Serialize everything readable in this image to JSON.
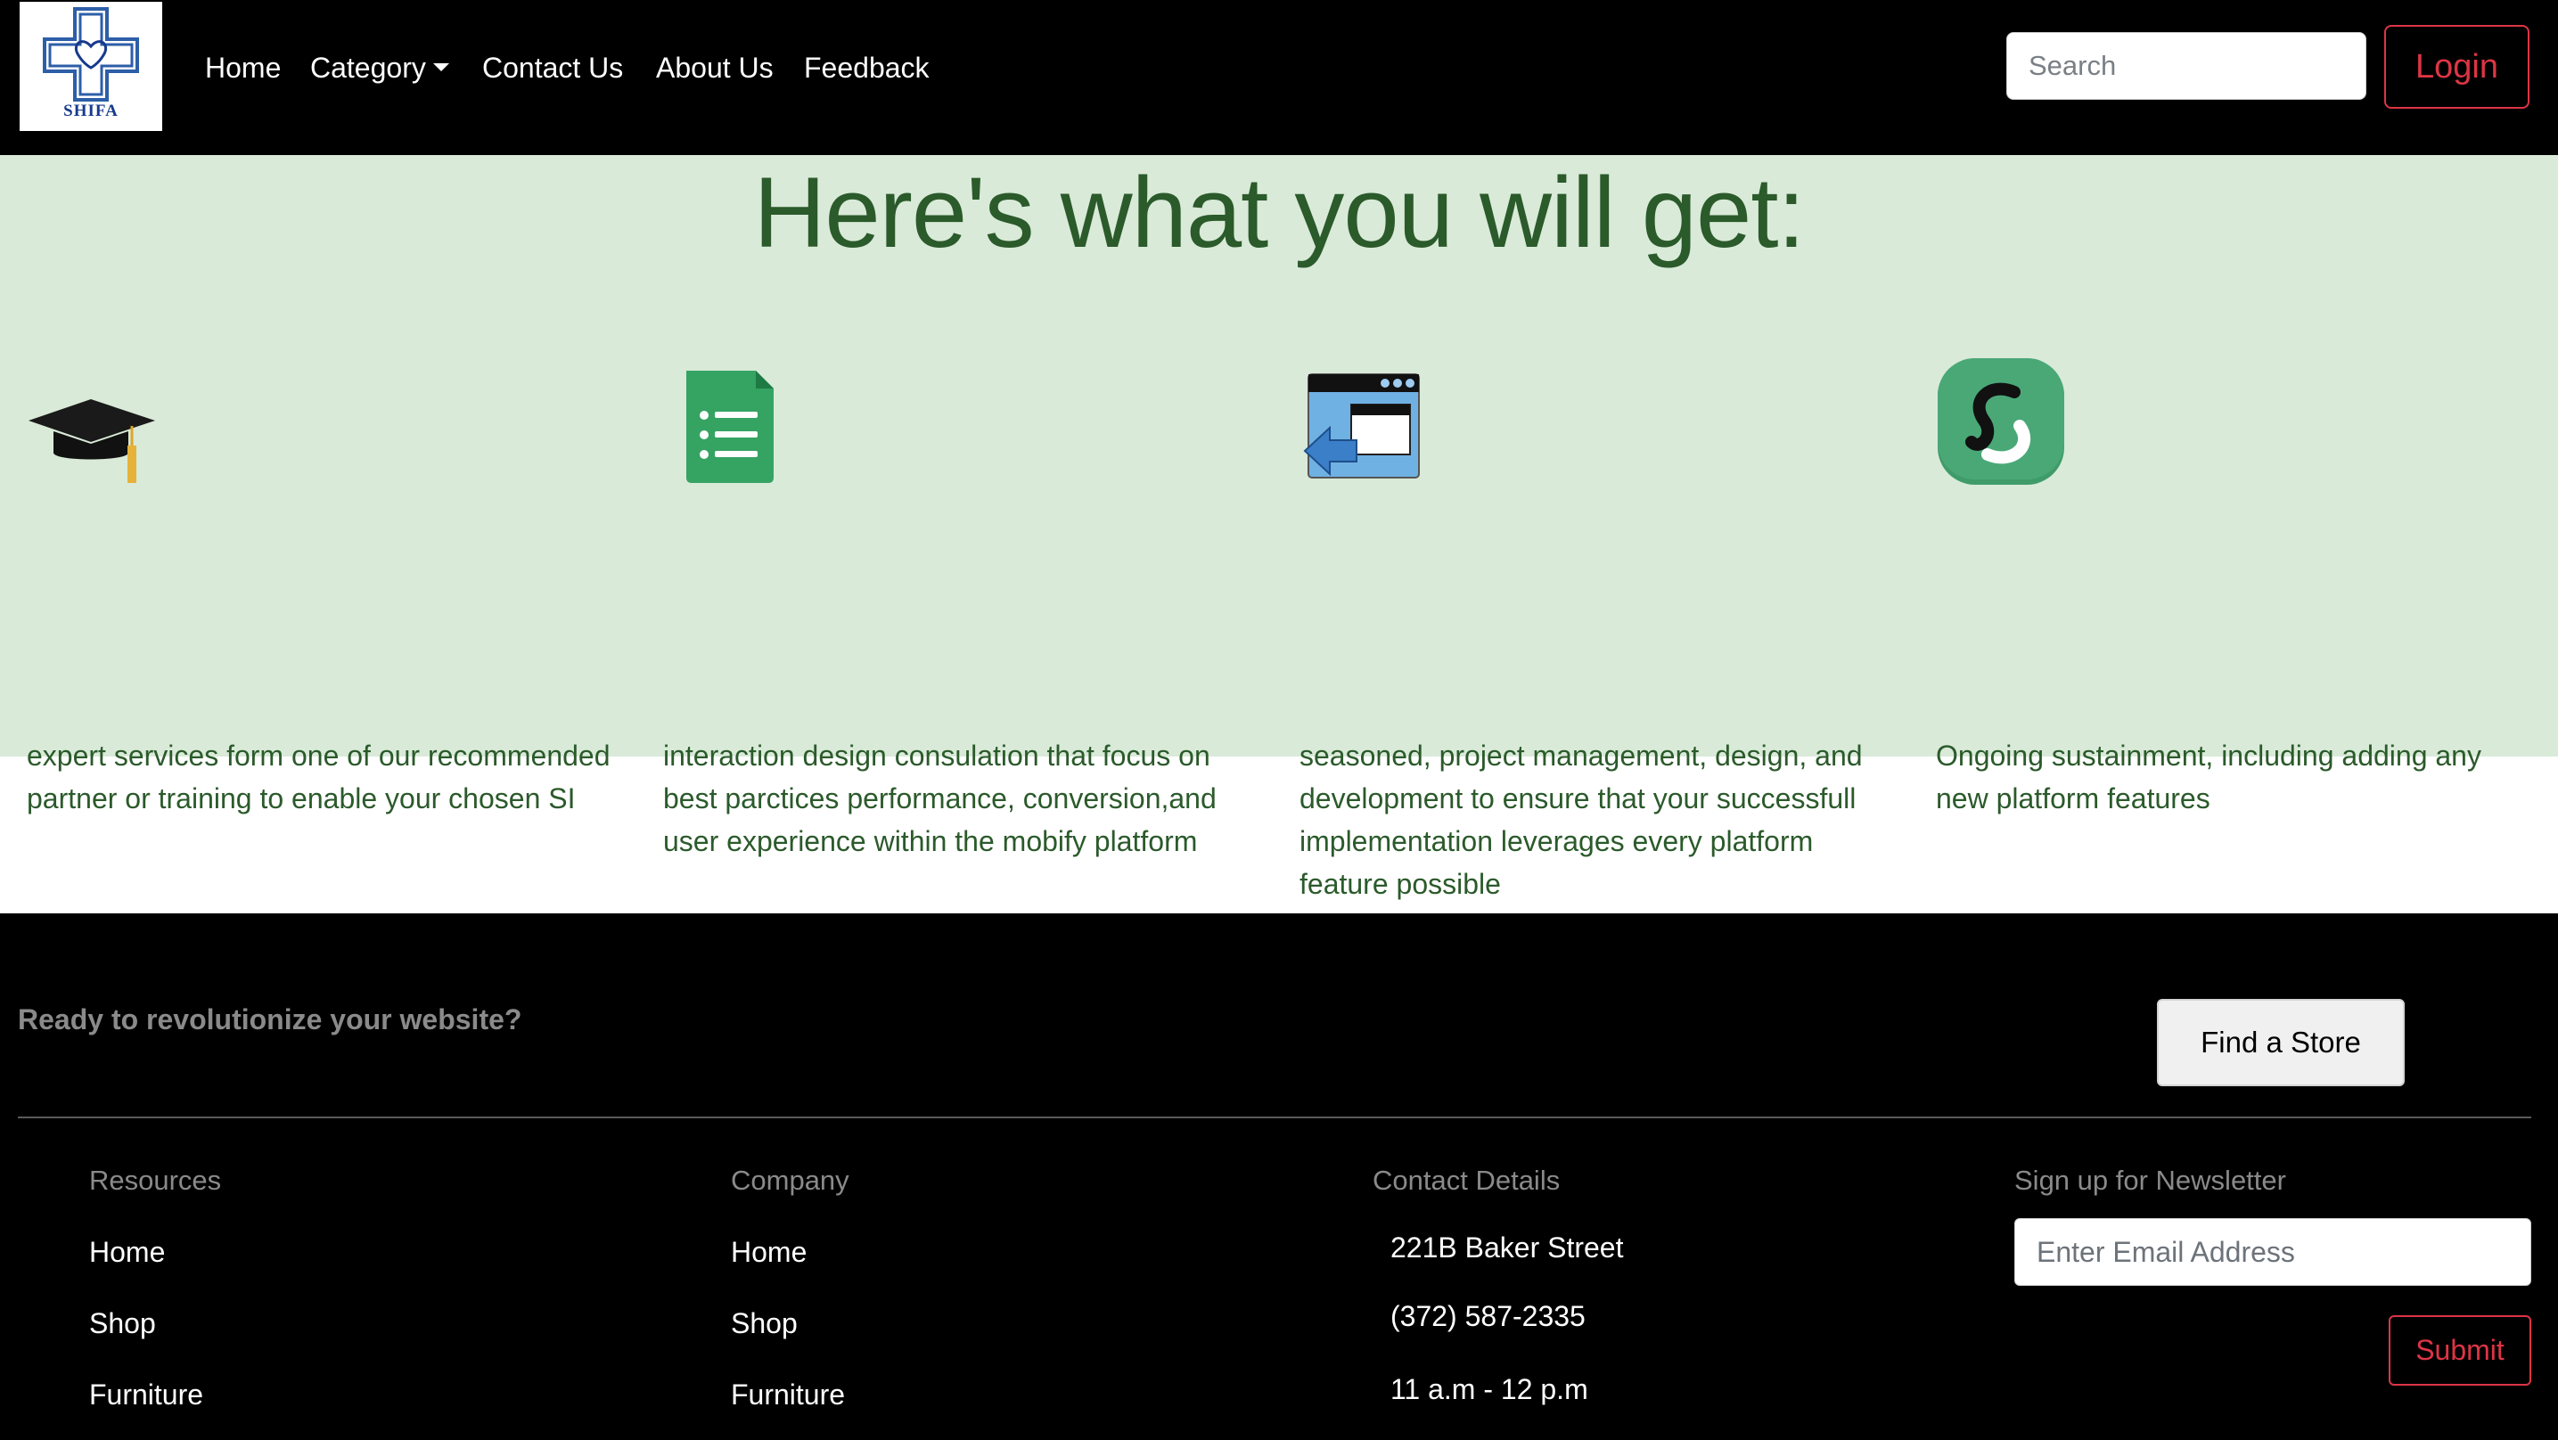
{
  "navbar": {
    "logo_text": "SHIFA",
    "links": [
      "Home",
      "Category",
      "Contact Us",
      "About Us",
      "Feedback"
    ],
    "search_placeholder": "Search",
    "login_label": "Login"
  },
  "features": {
    "title": "Here's what you will get:",
    "items": [
      {
        "icon": "graduation-cap-icon",
        "text": "expert services form one of our recommended partner or training to enable your chosen SI"
      },
      {
        "icon": "document-list-icon",
        "text": "interaction design consulation that focus on best parctices performance, conversion,and user experience within the mobify platform"
      },
      {
        "icon": "browser-window-icon",
        "text": "seasoned, project management, design, and development to ensure that your successfull implementation leverages every platform feature possible"
      },
      {
        "icon": "sync-circle-icon",
        "text": "Ongoing sustainment, including adding any new platform features"
      }
    ]
  },
  "footer": {
    "cta_text": "Ready to revolutionize your website?",
    "find_store_label": "Find a Store",
    "resources": {
      "heading": "Resources",
      "links": [
        "Home",
        "Shop",
        "Furniture"
      ]
    },
    "company": {
      "heading": "Company",
      "links": [
        "Home",
        "Shop",
        "Furniture"
      ]
    },
    "contact": {
      "heading": "Contact Details",
      "address": "221B Baker Street",
      "phone": "(372) 587-2335",
      "hours": "11 a.m - 12 p.m"
    },
    "newsletter": {
      "heading": "Sign up for Newsletter",
      "email_placeholder": "Enter Email Address",
      "submit_label": "Submit"
    }
  },
  "colors": {
    "nav_bg": "#000000",
    "features_bg": "#d9ead8",
    "features_text": "#2b5a2b",
    "accent_red": "#dc3545"
  }
}
